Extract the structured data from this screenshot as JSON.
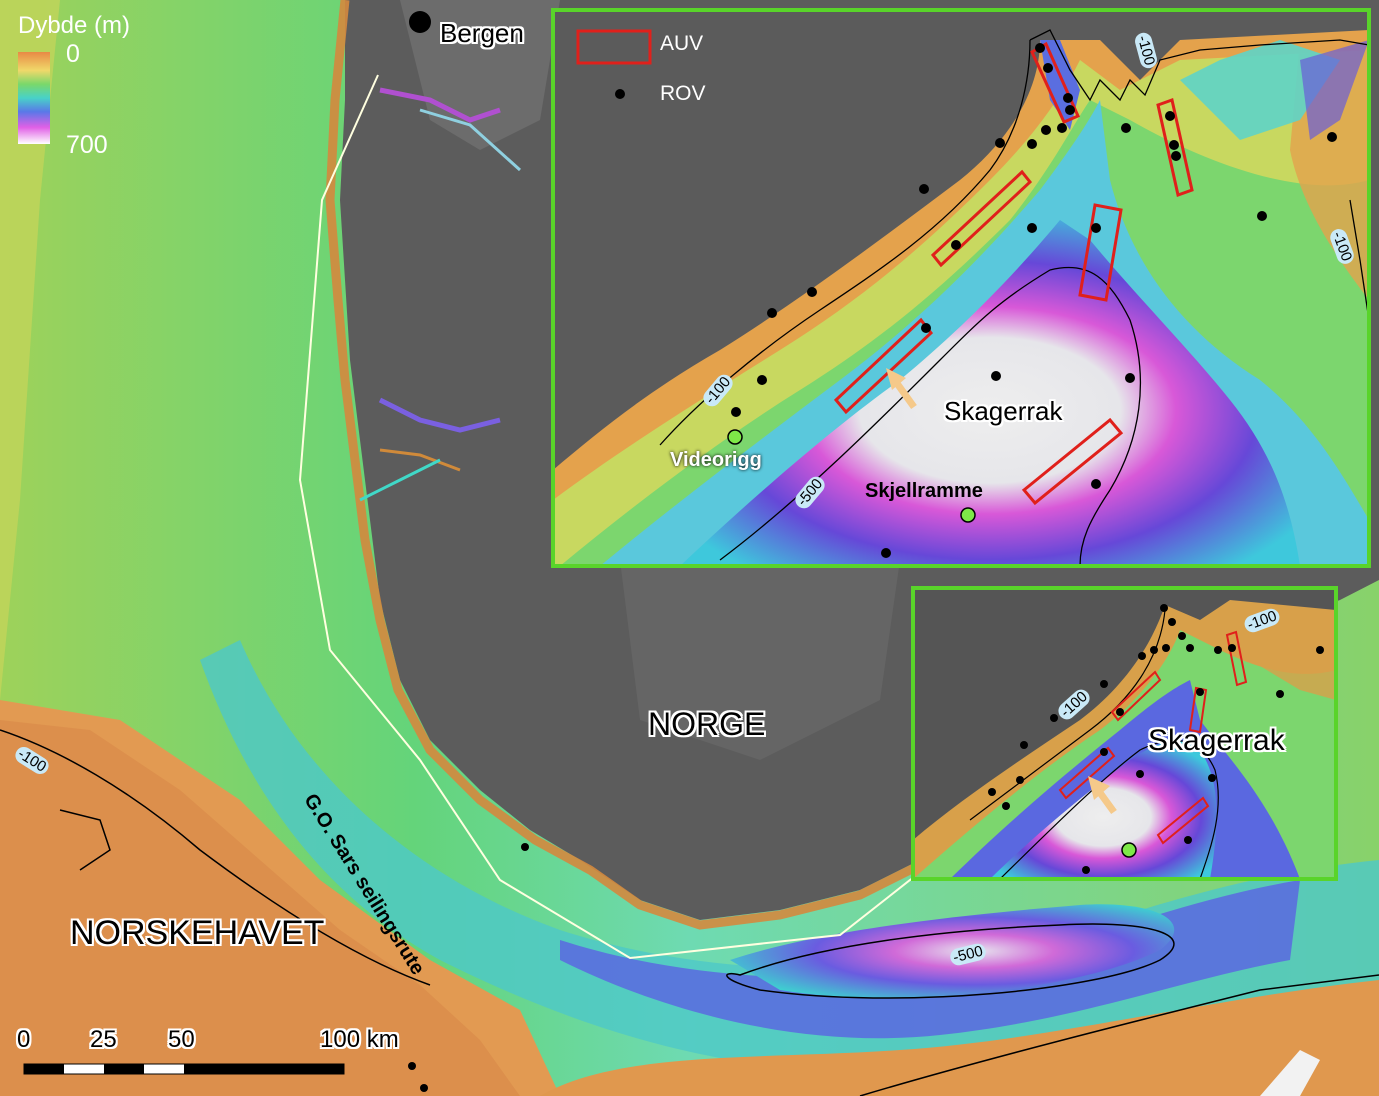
{
  "legend": {
    "title": "Dybde (m)",
    "min": "0",
    "max": "700"
  },
  "places": {
    "bergen": "Bergen",
    "norge": "NORGE",
    "norskehavet": "NORSKEHAVET",
    "skagerrak_main": "Skagerrak",
    "route": "G.O. Sars seilingsrute"
  },
  "contours": {
    "main_left": "-100",
    "main_bottom": "-500",
    "inset_top_a": "-100",
    "inset_top_b": "-100",
    "inset_left": "-100",
    "inset_bottom": "-500",
    "small_left": "-100",
    "small_right": "-100"
  },
  "inset_large": {
    "legend_auv": "AUV",
    "legend_rov": "ROV",
    "skagerrak": "Skagerrak",
    "videorigg": "Videorigg",
    "skjellramme": "Skjellramme"
  },
  "inset_small": {
    "skagerrak": "Skagerrak"
  },
  "scalebar": {
    "t0": "0",
    "t25": "25",
    "t50": "50",
    "t100": "100 km"
  },
  "colors": {
    "land": "#5a5a5a",
    "inset_frame": "#59d42a",
    "auv": "#e0201b",
    "rov": "#000000",
    "station_green": "#7ee848",
    "arrow": "#f5c98a"
  }
}
